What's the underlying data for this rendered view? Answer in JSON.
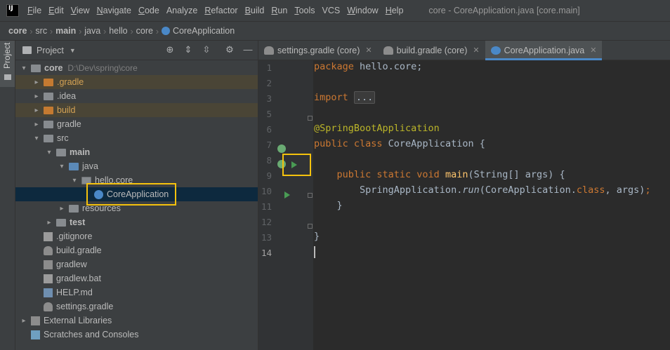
{
  "menubar": {
    "items": [
      {
        "label": "File",
        "u": "F",
        "rest": "ile"
      },
      {
        "label": "Edit",
        "u": "E",
        "rest": "dit"
      },
      {
        "label": "View",
        "u": "V",
        "rest": "iew"
      },
      {
        "label": "Navigate",
        "u": "N",
        "rest": "avigate"
      },
      {
        "label": "Code",
        "u": "C",
        "rest": "ode"
      },
      {
        "label": "Analyze",
        "u": "",
        "rest": "Analyze"
      },
      {
        "label": "Refactor",
        "u": "R",
        "rest": "efactor"
      },
      {
        "label": "Build",
        "u": "B",
        "rest": "uild"
      },
      {
        "label": "Run",
        "u": "R",
        "rest": "un"
      },
      {
        "label": "Tools",
        "u": "T",
        "rest": "ools"
      },
      {
        "label": "VCS",
        "u": "",
        "rest": "VCS"
      },
      {
        "label": "Window",
        "u": "W",
        "rest": "indow"
      },
      {
        "label": "Help",
        "u": "H",
        "rest": "elp"
      }
    ],
    "window_title": "core - CoreApplication.java [core.main]"
  },
  "breadcrumbs": [
    "core",
    "src",
    "main",
    "java",
    "hello",
    "core",
    "CoreApplication"
  ],
  "toolstripe": {
    "project_tab": "Project"
  },
  "project_panel": {
    "title": "Project",
    "tree": [
      {
        "label": "core",
        "path": "D:\\Dev\\spring\\core",
        "bold": true,
        "icon": "folder-gray",
        "chev": "▾",
        "hl": ""
      },
      {
        "label": ".gradle",
        "icon": "folder-orange",
        "chev": "▸",
        "hl": "orange"
      },
      {
        "label": ".idea",
        "icon": "folder-gray",
        "chev": "▸",
        "hl": ""
      },
      {
        "label": "build",
        "icon": "folder-orange",
        "chev": "▸",
        "hl": "orange"
      },
      {
        "label": "gradle",
        "icon": "folder-gray",
        "chev": "▸",
        "hl": ""
      },
      {
        "label": "src",
        "icon": "folder-gray",
        "chev": "▾",
        "hl": ""
      },
      {
        "label": "main",
        "bold": true,
        "icon": "folder-gray",
        "chev": "▾",
        "hl": ""
      },
      {
        "label": "java",
        "icon": "folder-blue",
        "chev": "▾",
        "hl": ""
      },
      {
        "label": "hello.core",
        "icon": "folder-pkg",
        "chev": "▾",
        "hl": ""
      },
      {
        "label": "CoreApplication",
        "icon": "spring-class",
        "chev": "",
        "hl": "selected"
      },
      {
        "label": "resources",
        "icon": "folder-gray",
        "chev": "▸",
        "hl": ""
      },
      {
        "label": "test",
        "bold": true,
        "icon": "folder-gray",
        "chev": "▸",
        "hl": ""
      },
      {
        "label": ".gitignore",
        "icon": "file-gitignore",
        "chev": "",
        "hl": ""
      },
      {
        "label": "build.gradle",
        "icon": "gradle-icon",
        "chev": "",
        "hl": ""
      },
      {
        "label": "gradlew",
        "icon": "terminal-file",
        "chev": "",
        "hl": ""
      },
      {
        "label": "gradlew.bat",
        "icon": "file-text",
        "chev": "",
        "hl": ""
      },
      {
        "label": "HELP.md",
        "icon": "markdown-file",
        "chev": "",
        "hl": ""
      },
      {
        "label": "settings.gradle",
        "icon": "gradle-icon",
        "chev": "",
        "hl": ""
      },
      {
        "label": "External Libraries",
        "icon": "library",
        "chev": "▸",
        "hl": ""
      },
      {
        "label": "Scratches and Consoles",
        "icon": "scratches",
        "chev": "",
        "hl": ""
      }
    ]
  },
  "editor": {
    "tabs": [
      {
        "label": "settings.gradle (core)",
        "active": false
      },
      {
        "label": "build.gradle (core)",
        "active": false
      },
      {
        "label": "CoreApplication.java",
        "active": true
      }
    ],
    "lines": [
      "1",
      "2",
      "3",
      "5",
      "6",
      "7",
      "8",
      "9",
      "10",
      "11",
      "12",
      "13",
      "14"
    ]
  },
  "colors": {
    "keyword": "#cc7832",
    "annotation": "#bbb529",
    "method": "#ffc66d",
    "highlight_box": "#f4c20d",
    "selection": "#0d293e"
  }
}
